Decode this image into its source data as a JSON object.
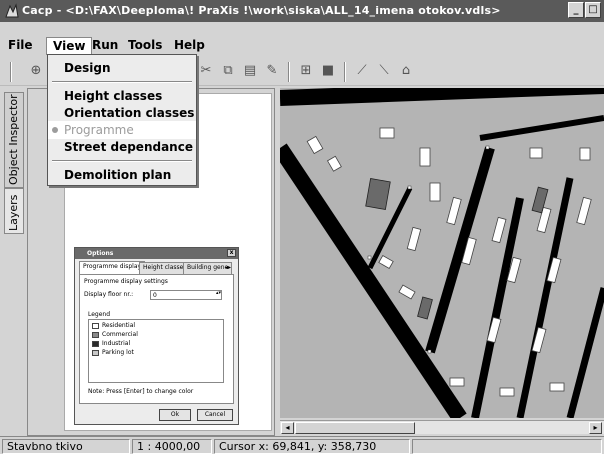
{
  "window": {
    "title": "Cacp - <D:\\FAX\\Deeploma\\! PraXis !\\work\\siska\\ALL_14_imena otokov.vdls>",
    "icon": "app-logo-icon",
    "controls": [
      "minimize-icon",
      "maximize-icon"
    ]
  },
  "menubar": {
    "items": [
      "File",
      "View",
      "Run",
      "Tools",
      "Help"
    ],
    "active": "View"
  },
  "view_menu": {
    "items": [
      {
        "label": "Design",
        "enabled": true
      },
      {
        "label": "Height classes",
        "enabled": true
      },
      {
        "label": "Orientation classes",
        "enabled": true
      },
      {
        "label": "Programme",
        "enabled": false,
        "checked": true
      },
      {
        "label": "Street dependance",
        "enabled": true
      },
      {
        "label": "Demolition plan",
        "enabled": true
      }
    ]
  },
  "side_tabs": {
    "inspector": "Object Inspector",
    "layers": "Layers"
  },
  "options_dialog": {
    "title": "Options",
    "tabs": [
      "Programme display",
      "Height classes",
      "Building gene"
    ],
    "section": "Programme display settings",
    "display_floor_label": "Display floor nr.:",
    "display_floor_value": "0",
    "legend_title": "Legend",
    "legend": [
      {
        "label": "Residential",
        "color": "#ffffff"
      },
      {
        "label": "Commercial",
        "color": "#8a8a8a"
      },
      {
        "label": "Industrial",
        "color": "#2a2a2a"
      },
      {
        "label": "Parking lot",
        "color": "#c8c8c8"
      }
    ],
    "note": "Note: Press [Enter] to change color",
    "ok": "Ok",
    "cancel": "Cancel"
  },
  "statusbar": {
    "layer": "Stavbno tkivo",
    "scale": "1 : 4000,00",
    "cursor": "Cursor x: 69,841, y: 358,730"
  },
  "colors": {
    "titlebar": "#5a5a5a",
    "map_background": "#b4b4b4",
    "road": "#000000"
  }
}
